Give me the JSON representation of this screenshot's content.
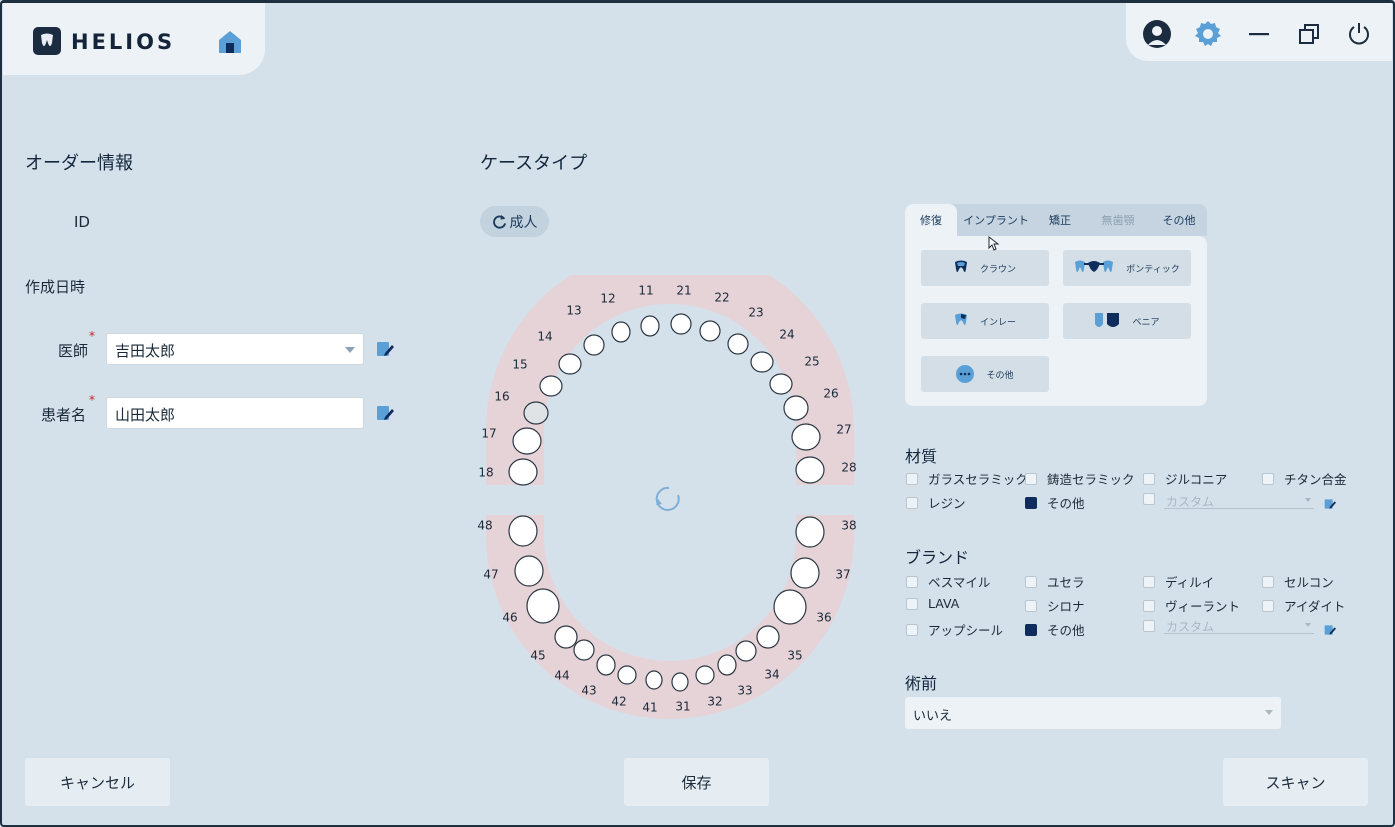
{
  "app": {
    "logo_text": "HELIOS"
  },
  "order": {
    "title": "オーダー情報",
    "id_label": "ID",
    "created_label": "作成日時",
    "doctor_label": "医師",
    "doctor_value": "吉田太郎",
    "patient_label": "患者名",
    "patient_value": "山田太郎",
    "required_mark": "*"
  },
  "case": {
    "title": "ケースタイプ",
    "age_label": "成人"
  },
  "teeth": {
    "upper_right": [
      "18",
      "17",
      "16",
      "15",
      "14",
      "13",
      "12",
      "11"
    ],
    "upper_left": [
      "21",
      "22",
      "23",
      "24",
      "25",
      "26",
      "27",
      "28"
    ],
    "lower_left": [
      "31",
      "32",
      "33",
      "34",
      "35",
      "36",
      "37",
      "38"
    ],
    "lower_right": [
      "41",
      "42",
      "43",
      "44",
      "45",
      "46",
      "47",
      "48"
    ]
  },
  "tabs": [
    "修復",
    "インプラント",
    "矯正",
    "無歯顎",
    "その他"
  ],
  "restoration": [
    "クラウン",
    "ポンティック",
    "インレー",
    "ベニア",
    "その他"
  ],
  "material": {
    "title": "材質",
    "options": [
      "ガラスセラミック",
      "鋳造セラミック",
      "ジルコニア",
      "チタン合金",
      "レジン",
      "その他"
    ],
    "checked": "その他",
    "custom_placeholder": "カスタム"
  },
  "brand": {
    "title": "ブランド",
    "options": [
      "ベスマイル",
      "ユセラ",
      "ディルイ",
      "セルコン",
      "LAVA",
      "シロナ",
      "ヴィーラント",
      "アイダイト",
      "アップシール",
      "その他"
    ],
    "checked": "その他",
    "custom_placeholder": "カスタム"
  },
  "preop": {
    "title": "術前",
    "value": "いいえ"
  },
  "footer": {
    "cancel": "キャンセル",
    "save": "保存",
    "scan": "スキャン"
  },
  "colors": {
    "background": "#d5e1ea",
    "accent": "#0e2d5c",
    "gum": "#e5d3d7"
  }
}
